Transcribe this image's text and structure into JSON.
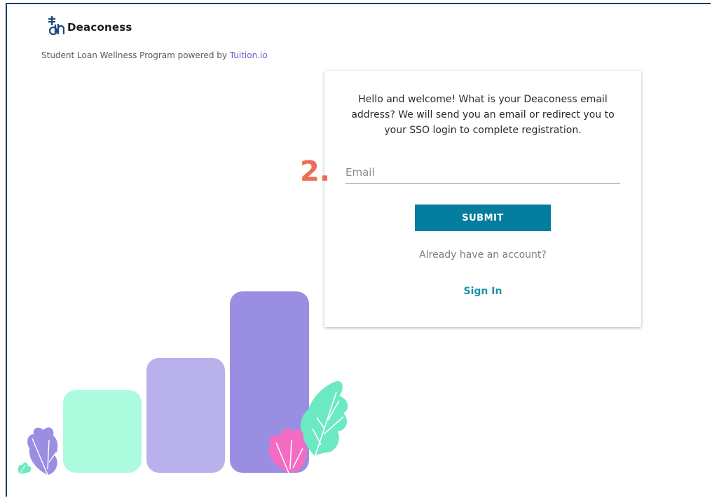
{
  "brand": {
    "logo_icon": "dh-monogram-icon",
    "name": "Deaconess"
  },
  "tagline": {
    "text": "Student Loan Wellness Program powered by ",
    "link": "Tuition.io"
  },
  "step": {
    "number": "2."
  },
  "registration": {
    "welcome": "Hello and welcome! What is your Deaconess email address? We will send you an email or redirect you to your SSO login to complete registration.",
    "email_placeholder": "Email",
    "email_value": "",
    "submit_label": "SUBMIT",
    "already_text": "Already have an account?",
    "signin_label": "Sign In"
  },
  "colors": {
    "primary_button": "#057d9f",
    "link_teal": "#1d8fa8",
    "step_marker": "#ee6c57",
    "tuition_link": "#6a5acd",
    "bar_mint": "#adfbdf",
    "bar_lavender": "#b9b1eb",
    "bar_purple": "#9a8ee3",
    "leaf_green": "#6be9c3",
    "leaf_pink": "#f36cc2"
  },
  "icons": [
    "dh-monogram-icon",
    "leaf-icon"
  ]
}
